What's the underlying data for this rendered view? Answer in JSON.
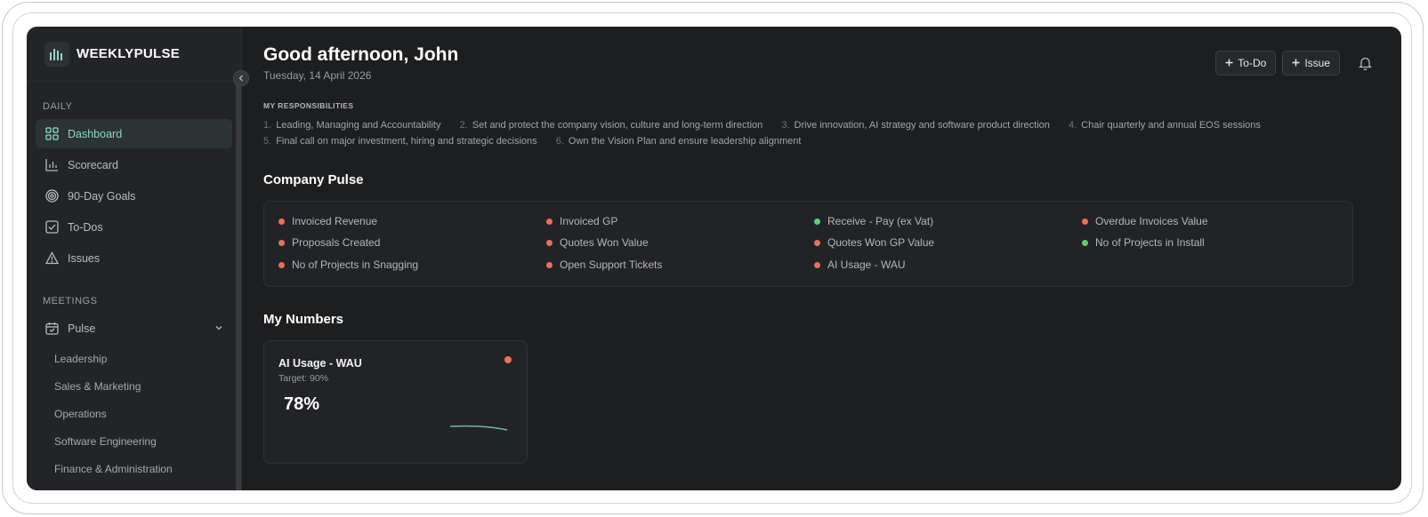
{
  "brand": {
    "name": "WEEKLYPULSE"
  },
  "sidebar": {
    "daily_label": "DAILY",
    "items": [
      {
        "label": "Dashboard",
        "icon": "grid-icon",
        "active": true
      },
      {
        "label": "Scorecard",
        "icon": "bar-chart-icon"
      },
      {
        "label": "90-Day Goals",
        "icon": "target-icon"
      },
      {
        "label": "To-Dos",
        "icon": "checkbox-icon"
      },
      {
        "label": "Issues",
        "icon": "warning-icon"
      }
    ],
    "meetings_label": "MEETINGS",
    "pulse": {
      "label": "Pulse",
      "icon": "calendar-icon"
    },
    "sub_items": [
      "Leadership",
      "Sales & Marketing",
      "Operations",
      "Software Engineering",
      "Finance & Administration"
    ]
  },
  "header": {
    "greeting": "Good afternoon, John",
    "date": "Tuesday, 14 April 2026",
    "todo_label": "To-Do",
    "issue_label": "Issue"
  },
  "responsibilities": {
    "title": "MY RESPONSIBILITIES",
    "items": [
      {
        "num": "1.",
        "text": "Leading, Managing and Accountability"
      },
      {
        "num": "2.",
        "text": "Set and protect the company vision, culture and long-term direction"
      },
      {
        "num": "3.",
        "text": "Drive innovation, AI strategy and software product direction"
      },
      {
        "num": "4.",
        "text": "Chair quarterly and annual EOS sessions"
      },
      {
        "num": "5.",
        "text": "Final call on major investment, hiring and strategic decisions"
      },
      {
        "num": "6.",
        "text": "Own the Vision Plan and ensure leadership alignment"
      }
    ]
  },
  "company_pulse": {
    "title": "Company Pulse",
    "metrics": [
      {
        "label": "Invoiced Revenue",
        "status": "red"
      },
      {
        "label": "Invoiced GP",
        "status": "red"
      },
      {
        "label": "Receive - Pay (ex Vat)",
        "status": "green"
      },
      {
        "label": "Overdue Invoices Value",
        "status": "red"
      },
      {
        "label": "Proposals Created",
        "status": "red"
      },
      {
        "label": "Quotes Won Value",
        "status": "red"
      },
      {
        "label": "Quotes Won GP Value",
        "status": "red"
      },
      {
        "label": "No of Projects in Install",
        "status": "green"
      },
      {
        "label": "No of Projects in Snagging",
        "status": "red"
      },
      {
        "label": "Open Support Tickets",
        "status": "red"
      },
      {
        "label": "AI Usage - WAU",
        "status": "red"
      }
    ]
  },
  "my_numbers": {
    "title": "My Numbers",
    "card": {
      "title": "AI Usage - WAU",
      "target": "Target: 90%",
      "value": "78%",
      "status": "red"
    }
  },
  "colors": {
    "red": "#e8715a",
    "green": "#5fcf7a",
    "accent": "#8fd6c7",
    "spark": "#6fb3b0"
  }
}
